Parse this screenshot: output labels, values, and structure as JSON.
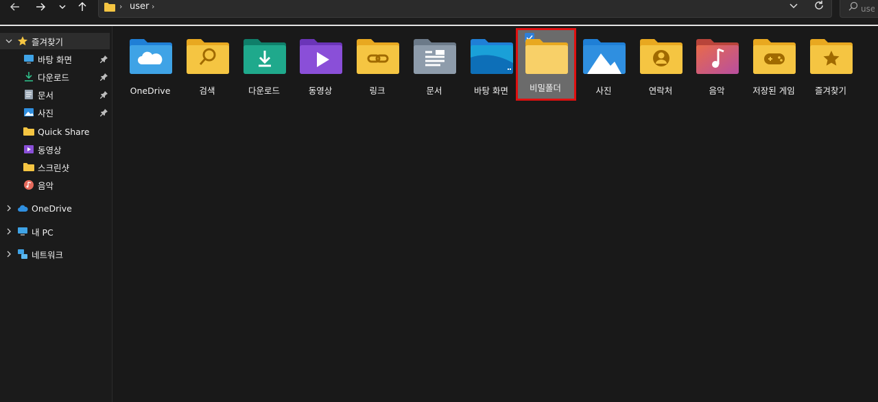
{
  "address": {
    "path": "user",
    "search_placeholder": "user 검색"
  },
  "sidebar": {
    "quick_access": {
      "label": "즐겨찾기",
      "items": [
        {
          "label": "바탕 화면",
          "icon": "desktop-icon",
          "pinned": true
        },
        {
          "label": "다운로드",
          "icon": "download-icon",
          "pinned": true
        },
        {
          "label": "문서",
          "icon": "document-icon",
          "pinned": true
        },
        {
          "label": "사진",
          "icon": "pictures-icon",
          "pinned": true
        },
        {
          "label": "Quick Share",
          "icon": "folder-icon",
          "pinned": false
        },
        {
          "label": "동영상",
          "icon": "video-icon",
          "pinned": false
        },
        {
          "label": "스크린샷",
          "icon": "folder-icon",
          "pinned": false
        },
        {
          "label": "음악",
          "icon": "music-icon",
          "pinned": false
        }
      ]
    },
    "onedrive": {
      "label": "OneDrive"
    },
    "this_pc": {
      "label": "내 PC"
    },
    "network": {
      "label": "네트워크"
    }
  },
  "items": [
    {
      "label": "OneDrive",
      "icon": "onedrive-folder-icon"
    },
    {
      "label": "검색",
      "icon": "search-folder-icon"
    },
    {
      "label": "다운로드",
      "icon": "downloads-folder-icon"
    },
    {
      "label": "동영상",
      "icon": "videos-folder-icon"
    },
    {
      "label": "링크",
      "icon": "links-folder-icon"
    },
    {
      "label": "문서",
      "icon": "documents-folder-icon"
    },
    {
      "label": "바탕 화면",
      "icon": "desktop-folder-icon"
    },
    {
      "label": "비밀폴더",
      "icon": "folder-icon",
      "selected": true
    },
    {
      "label": "사진",
      "icon": "pictures-folder-icon"
    },
    {
      "label": "연락처",
      "icon": "contacts-folder-icon"
    },
    {
      "label": "음악",
      "icon": "music-folder-icon"
    },
    {
      "label": "저장된 게임",
      "icon": "saved-games-folder-icon"
    },
    {
      "label": "즐겨찾기",
      "icon": "favorites-folder-icon"
    }
  ],
  "colors": {
    "selection_outline": "#e01010",
    "accent": "#2f7fd8",
    "folder": "#f5c542"
  }
}
